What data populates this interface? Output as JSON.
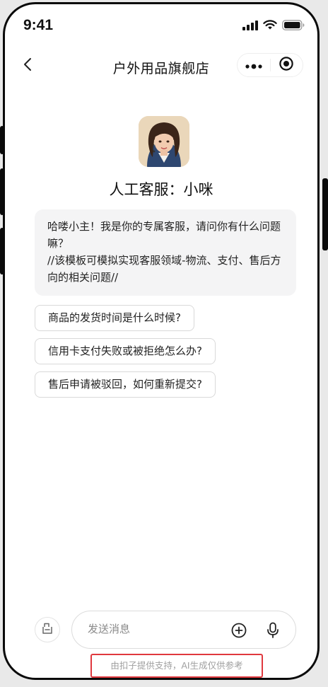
{
  "status_bar": {
    "time": "9:41",
    "icons": [
      "signal-icon",
      "wifi-icon",
      "battery-icon"
    ]
  },
  "nav": {
    "back_icon": "chevron-left-icon",
    "title": "户外用品旗舰店",
    "more_icon": "more-dots-icon",
    "close_icon": "close-target-icon"
  },
  "agent": {
    "avatar": "agent-avatar",
    "name": "人工客服：小咪"
  },
  "greeting": {
    "line1": "哈喽小主！我是你的专属客服，请问你有什么问题嘛？",
    "line2": "//该模板可模拟实现客服领域-物流、支付、售后方向的相关问题//"
  },
  "suggestions": [
    "商品的发货时间是什么时候?",
    "信用卡支付失败或被拒绝怎么办?",
    "售后申请被驳回，如何重新提交?"
  ],
  "input": {
    "placeholder": "发送消息",
    "value": "",
    "shop_icon": "shop-icon",
    "plus_icon": "plus-circle-icon",
    "mic_icon": "mic-icon"
  },
  "footer": {
    "note": "由扣子提供支持，AI生成仅供参考"
  },
  "colors": {
    "highlight_border": "#e0383e",
    "bubble_bg": "#f4f4f5",
    "text": "#222222"
  }
}
